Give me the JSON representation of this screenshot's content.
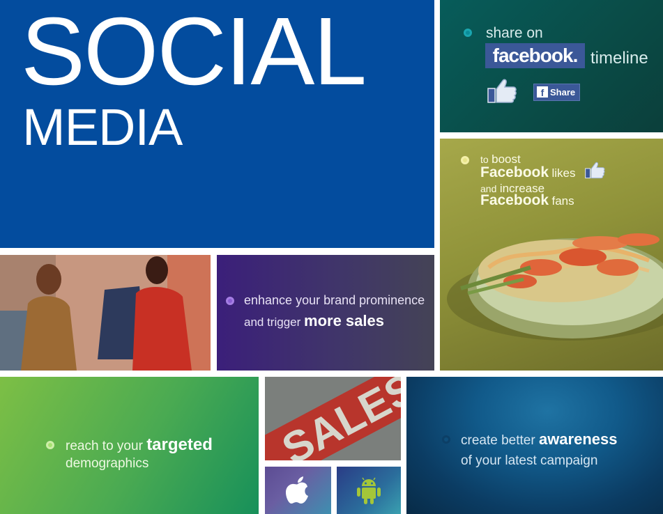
{
  "social_tile": {
    "title_line1": "SOCIAL",
    "title_line2": "MEDIA",
    "background": "#034c9e"
  },
  "share_tile": {
    "share_on": "share on",
    "facebook_logo": "facebook.",
    "timeline": "timeline",
    "share_button_icon": "f",
    "share_button_label": "Share",
    "accent": "#1aa6b0"
  },
  "boost_tile": {
    "to": "to",
    "boost": "boost",
    "facebook_1": "Facebook",
    "likes": "likes",
    "and": "and",
    "increase": "increase",
    "facebook_2": "Facebook",
    "fans": "fans"
  },
  "brand_tile": {
    "line1": "enhance your brand prominence",
    "line2_prefix": "and trigger",
    "line2_strong": "more sales",
    "accent": "#8a5dd4"
  },
  "target_tile": {
    "line1_prefix": "reach to your",
    "line1_strong": "targeted",
    "line2": "demographics",
    "accent": "#a6e070"
  },
  "sales_tile": {
    "sign_text": "SALES"
  },
  "apple_tile": {
    "icon": "apple-icon"
  },
  "android_tile": {
    "icon": "android-icon"
  },
  "aware_tile": {
    "line1_prefix": "create better",
    "line1_strong": "awareness",
    "line2": "of your latest campaign",
    "accent": "#0f4e7a"
  }
}
